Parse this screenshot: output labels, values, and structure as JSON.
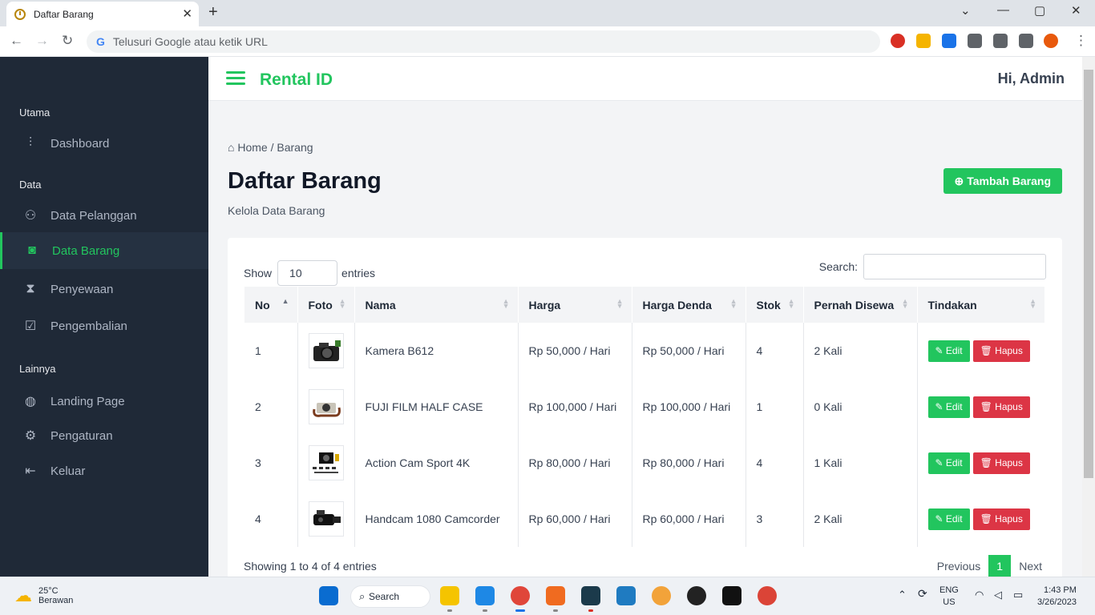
{
  "browser": {
    "tab_title": "Daftar Barang",
    "address_placeholder": "Telusuri Google atau ketik URL",
    "new_tab": "+",
    "close_tab": "✕"
  },
  "header": {
    "brand": "Rental ID",
    "greeting": "Hi, Admin"
  },
  "sidebar": {
    "sections": [
      {
        "label": "Utama"
      },
      {
        "label": "Data"
      },
      {
        "label": "Lainnya"
      }
    ],
    "items": [
      {
        "label": "Dashboard",
        "icon": "sliders-icon"
      },
      {
        "label": "Data Pelanggan",
        "icon": "users-icon"
      },
      {
        "label": "Data Barang",
        "icon": "camera-icon",
        "active": true
      },
      {
        "label": "Penyewaan",
        "icon": "hourglass-icon"
      },
      {
        "label": "Pengembalian",
        "icon": "check-square-icon"
      },
      {
        "label": "Landing Page",
        "icon": "globe-icon"
      },
      {
        "label": "Pengaturan",
        "icon": "gear-icon"
      },
      {
        "label": "Keluar",
        "icon": "logout-icon"
      }
    ]
  },
  "page": {
    "breadcrumb_home": "Home",
    "breadcrumb_sep": " / ",
    "breadcrumb_current": "Barang",
    "title": "Daftar Barang",
    "subtitle": "Kelola Data Barang",
    "add_button": "Tambah Barang"
  },
  "table_controls": {
    "show_label": "Show",
    "entries_value": "10",
    "entries_label": "entries",
    "search_label": "Search:"
  },
  "table": {
    "columns": [
      "No",
      "Foto",
      "Nama",
      "Harga",
      "Harga Denda",
      "Stok",
      "Pernah Disewa",
      "Tindakan"
    ],
    "rows": [
      {
        "no": "1",
        "photo": "camera-photo",
        "name": "Kamera B612",
        "price": "Rp 50,000 / Hari",
        "fine": "Rp 50,000 / Hari",
        "stock": "4",
        "rented": "2 Kali"
      },
      {
        "no": "2",
        "photo": "fuji-camera-photo",
        "name": "FUJI FILM HALF CASE",
        "price": "Rp 100,000 / Hari",
        "fine": "Rp 100,000 / Hari",
        "stock": "1",
        "rented": "0 Kali"
      },
      {
        "no": "3",
        "photo": "action-cam-photo",
        "name": "Action Cam Sport 4K",
        "price": "Rp 80,000 / Hari",
        "fine": "Rp 80,000 / Hari",
        "stock": "4",
        "rented": "1 Kali"
      },
      {
        "no": "4",
        "photo": "handcam-photo",
        "name": "Handcam 1080 Camcorder",
        "price": "Rp 60,000 / Hari",
        "fine": "Rp 60,000 / Hari",
        "stock": "3",
        "rented": "2 Kali"
      }
    ],
    "edit_label": "Edit",
    "delete_label": "Hapus"
  },
  "footer": {
    "info": "Showing 1 to 4 of 4 entries",
    "prev": "Previous",
    "page": "1",
    "next": "Next"
  },
  "taskbar": {
    "temp": "25°C",
    "weather": "Berawan",
    "search": "Search",
    "lang": "ENG",
    "region": "US",
    "time": "1:43 PM",
    "date": "3/26/2023"
  },
  "colors": {
    "accent": "#22c55e",
    "danger": "#dc3545",
    "sidebar": "#1f2937"
  }
}
